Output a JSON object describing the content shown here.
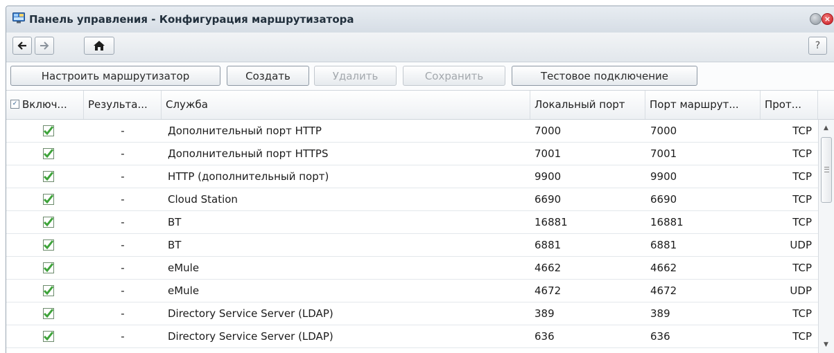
{
  "window": {
    "title": "Панель управления - Конфигурация маршрутизатора",
    "icons": {
      "app": "control-panel-icon",
      "minimize": "minimize-icon",
      "close": "close-icon"
    }
  },
  "nav": {
    "back_icon": "arrow-left-icon",
    "forward_icon": "arrow-right-icon",
    "home_icon": "home-icon",
    "help_label": "?"
  },
  "toolbar": {
    "configure_label": "Настроить маршрутизатор",
    "create_label": "Создать",
    "delete_label": "Удалить",
    "save_label": "Сохранить",
    "test_label": "Тестовое подключение"
  },
  "columns": {
    "enabled": "Включ...",
    "result": "Результа...",
    "service": "Служба",
    "local_port": "Локальный порт",
    "router_port": "Порт маршрут...",
    "protocol": "Прот..."
  },
  "rows": [
    {
      "enabled": true,
      "result": "-",
      "service": "Дополнительный порт HTTP",
      "local_port": "7000",
      "router_port": "7000",
      "protocol": "TCP"
    },
    {
      "enabled": true,
      "result": "-",
      "service": "Дополнительный порт HTTPS",
      "local_port": "7001",
      "router_port": "7001",
      "protocol": "TCP"
    },
    {
      "enabled": true,
      "result": "-",
      "service": "HTTP (дополнительный порт)",
      "local_port": "9900",
      "router_port": "9900",
      "protocol": "TCP"
    },
    {
      "enabled": true,
      "result": "-",
      "service": "Cloud Station",
      "local_port": "6690",
      "router_port": "6690",
      "protocol": "TCP"
    },
    {
      "enabled": true,
      "result": "-",
      "service": "BT",
      "local_port": "16881",
      "router_port": "16881",
      "protocol": "TCP"
    },
    {
      "enabled": true,
      "result": "-",
      "service": "BT",
      "local_port": "6881",
      "router_port": "6881",
      "protocol": "UDP"
    },
    {
      "enabled": true,
      "result": "-",
      "service": "eMule",
      "local_port": "4662",
      "router_port": "4662",
      "protocol": "TCP"
    },
    {
      "enabled": true,
      "result": "-",
      "service": "eMule",
      "local_port": "4672",
      "router_port": "4672",
      "protocol": "UDP"
    },
    {
      "enabled": true,
      "result": "-",
      "service": "Directory Service Server (LDAP)",
      "local_port": "389",
      "router_port": "389",
      "protocol": "TCP"
    },
    {
      "enabled": true,
      "result": "-",
      "service": "Directory Service Server (LDAP)",
      "local_port": "636",
      "router_port": "636",
      "protocol": "TCP"
    }
  ],
  "colors": {
    "check_green": "#3ea33a",
    "close_red": "#d8232a",
    "header_bg": "#e2e7ec"
  }
}
